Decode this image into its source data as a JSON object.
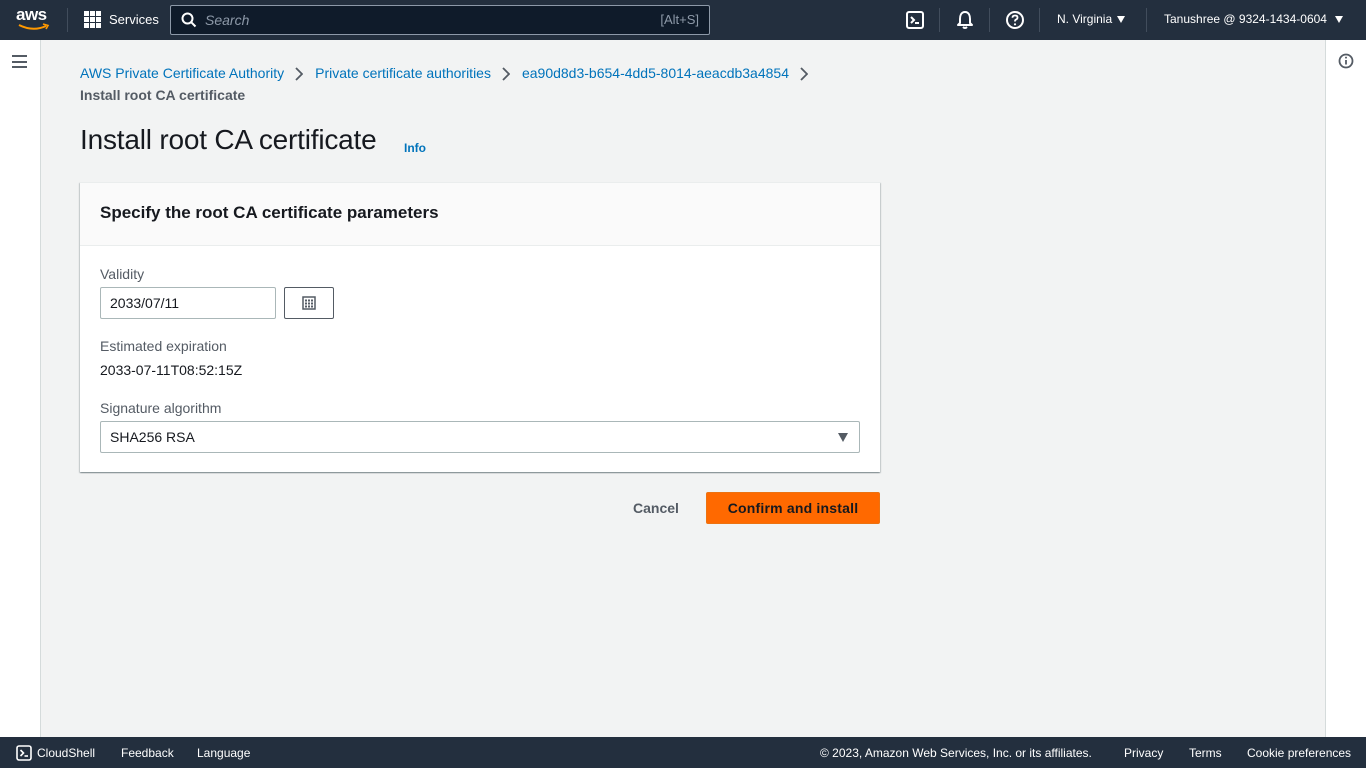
{
  "topnav": {
    "logo_text": "aws",
    "services_label": "Services",
    "search_placeholder": "Search",
    "search_shortcut": "[Alt+S]",
    "region": "N. Virginia",
    "account": "Tanushree @ 9324-1434-0604"
  },
  "breadcrumb": {
    "items": [
      "AWS Private Certificate Authority",
      "Private certificate authorities",
      "ea90d8d3-b654-4dd5-8014-aeacdb3a4854"
    ],
    "current": "Install root CA certificate"
  },
  "page": {
    "title": "Install root CA certificate",
    "info_link": "Info"
  },
  "form": {
    "header": "Specify the root CA certificate parameters",
    "validity_label": "Validity",
    "validity_value": "2033/07/11",
    "expiration_label": "Estimated expiration",
    "expiration_value": "2033-07-11T08:52:15Z",
    "algorithm_label": "Signature algorithm",
    "algorithm_value": "SHA256 RSA"
  },
  "actions": {
    "cancel": "Cancel",
    "confirm": "Confirm and install"
  },
  "footer": {
    "cloudshell": "CloudShell",
    "feedback": "Feedback",
    "language": "Language",
    "copyright": "© 2023, Amazon Web Services, Inc. or its affiliates.",
    "privacy": "Privacy",
    "terms": "Terms",
    "cookies": "Cookie preferences"
  },
  "colors": {
    "nav_bg": "#232f3e",
    "primary": "#ff6900",
    "link": "#0073bb",
    "page_bg": "#f2f3f3"
  }
}
